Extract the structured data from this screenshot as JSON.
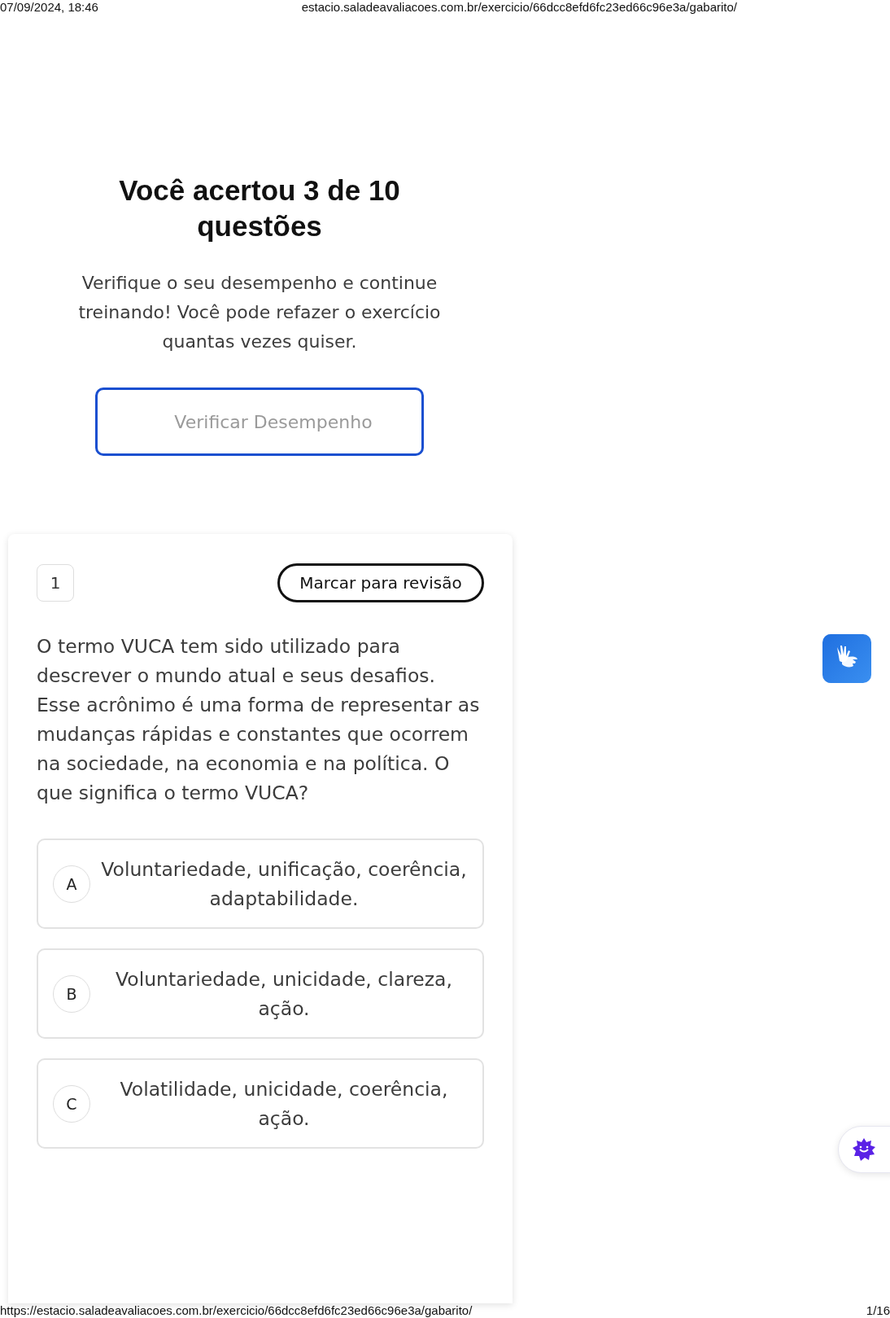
{
  "print_header": {
    "date": "07/09/2024, 18:46",
    "url": "estacio.saladeavaliacoes.com.br/exercicio/66dcc8efd6fc23ed66c96e3a/gabarito/"
  },
  "result": {
    "title": "Você acertou 3 de 10 questões",
    "message": "Verifique o seu desempenho e continue treinando! Você pode refazer o exercício quantas vezes quiser.",
    "button": "Verificar Desempenho"
  },
  "question": {
    "number": "1",
    "review_button": "Marcar para revisão",
    "text": "O termo VUCA tem sido utilizado para descrever o mundo atual e seus desafios. Esse acrônimo é uma forma de representar as mudanças rápidas e constantes que ocorrem na sociedade, na economia e na política. O que significa o termo VUCA?",
    "options": [
      {
        "letter": "A",
        "text": "Voluntariedade, unificação, coerência, adaptabilidade."
      },
      {
        "letter": "B",
        "text": "Voluntariedade, unicidade, clareza, ação."
      },
      {
        "letter": "C",
        "text": "Volatilidade, unicidade, coerência, ação."
      }
    ]
  },
  "print_footer": {
    "url": "https://estacio.saladeavaliacoes.com.br/exercicio/66dcc8efd6fc23ed66c96e3a/gabarito/",
    "page": "1/16"
  }
}
